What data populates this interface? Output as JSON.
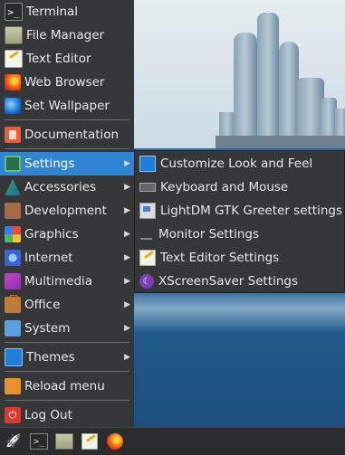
{
  "menu": {
    "items": [
      {
        "label": "Terminal",
        "icon": "terminal-icon"
      },
      {
        "label": "File Manager",
        "icon": "folder-icon"
      },
      {
        "label": "Text Editor",
        "icon": "text-editor-icon"
      },
      {
        "label": "Web Browser",
        "icon": "firefox-icon"
      },
      {
        "label": "Set Wallpaper",
        "icon": "globe-icon"
      },
      {
        "label": "Documentation",
        "icon": "documentation-icon"
      },
      {
        "label": "Settings",
        "icon": "settings-gear-icon",
        "has_submenu": true,
        "active": true
      },
      {
        "label": "Accessories",
        "icon": "accessories-icon",
        "has_submenu": true
      },
      {
        "label": "Development",
        "icon": "development-icon",
        "has_submenu": true
      },
      {
        "label": "Graphics",
        "icon": "graphics-icon",
        "has_submenu": true
      },
      {
        "label": "Internet",
        "icon": "internet-icon",
        "has_submenu": true
      },
      {
        "label": "Multimedia",
        "icon": "multimedia-icon",
        "has_submenu": true
      },
      {
        "label": "Office",
        "icon": "office-briefcase-icon",
        "has_submenu": true
      },
      {
        "label": "System",
        "icon": "system-icon",
        "has_submenu": true
      },
      {
        "label": "Themes",
        "icon": "themes-icon",
        "has_submenu": true
      },
      {
        "label": "Reload menu",
        "icon": "reload-icon"
      },
      {
        "label": "Log Out",
        "icon": "power-icon"
      }
    ],
    "arrow_glyph": "▶"
  },
  "submenu": {
    "items": [
      {
        "label": "Customize Look and Feel",
        "icon": "customize-icon"
      },
      {
        "label": "Keyboard and Mouse",
        "icon": "keyboard-icon"
      },
      {
        "label": "LightDM GTK Greeter settings",
        "icon": "lightdm-icon"
      },
      {
        "label": "Monitor Settings",
        "icon": "monitor-icon"
      },
      {
        "label": "Text Editor Settings",
        "icon": "text-editor-icon"
      },
      {
        "label": "XScreenSaver Settings",
        "icon": "screensaver-icon"
      }
    ]
  },
  "taskbar": {
    "items": [
      "launcher-rocket-icon",
      "terminal-icon",
      "folder-icon",
      "text-editor-icon",
      "firefox-icon"
    ],
    "terminal_glyph": ">_"
  },
  "colors": {
    "menu_bg": "#363739",
    "highlight": "#2f84d3",
    "text": "#e8e8e8"
  }
}
